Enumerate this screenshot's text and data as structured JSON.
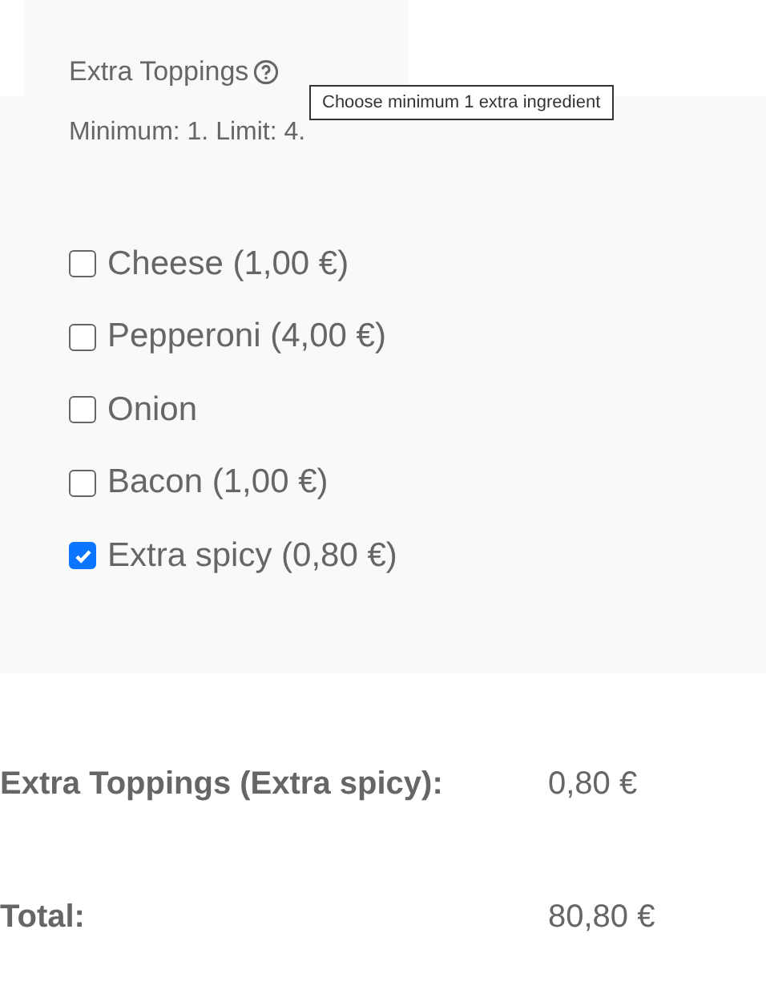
{
  "group": {
    "title": "Extra Toppings",
    "tooltip": "Choose minimum 1 extra ingredient",
    "rule": "Minimum: 1. Limit: 4."
  },
  "options": [
    {
      "label": "Cheese (1,00 €)",
      "checked": false
    },
    {
      "label": "Pepperoni (4,00 €)",
      "checked": false
    },
    {
      "label": "Onion",
      "checked": false
    },
    {
      "label": "Bacon (1,00 €)",
      "checked": false
    },
    {
      "label": "Extra spicy (0,80 €)",
      "checked": true
    }
  ],
  "summary": [
    {
      "label": "Extra Toppings (Extra spicy):",
      "value": "0,80 €"
    },
    {
      "label": "Total:",
      "value": "80,80 €"
    }
  ]
}
